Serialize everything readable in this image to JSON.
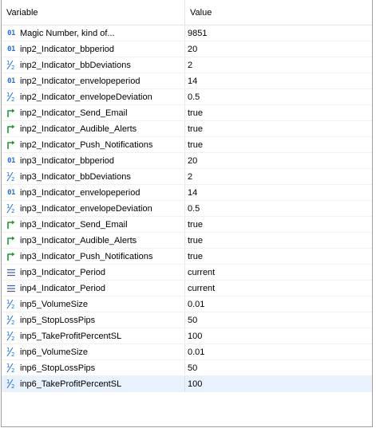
{
  "header": {
    "variable": "Variable",
    "value": "Value"
  },
  "icon_colors": {
    "int": "#2a6fc9",
    "double": "#2a6fc9",
    "bool": "#1f9a2e",
    "enum": "#3c5aa8"
  },
  "rows": [
    {
      "icon": "int-icon",
      "name": "Magic Number, kind of...",
      "value": "9851"
    },
    {
      "icon": "int-icon",
      "name": "inp2_Indicator_bbperiod",
      "value": "20"
    },
    {
      "icon": "double-icon",
      "name": "inp2_Indicator_bbDeviations",
      "value": "2"
    },
    {
      "icon": "int-icon",
      "name": "inp2_Indicator_envelopeperiod",
      "value": "14"
    },
    {
      "icon": "double-icon",
      "name": "inp2_Indicator_envelopeDeviation",
      "value": "0.5"
    },
    {
      "icon": "bool-icon",
      "name": "inp2_Indicator_Send_Email",
      "value": "true"
    },
    {
      "icon": "bool-icon",
      "name": "inp2_Indicator_Audible_Alerts",
      "value": "true"
    },
    {
      "icon": "bool-icon",
      "name": "inp2_Indicator_Push_Notifications",
      "value": "true"
    },
    {
      "icon": "int-icon",
      "name": "inp3_Indicator_bbperiod",
      "value": "20"
    },
    {
      "icon": "double-icon",
      "name": "inp3_Indicator_bbDeviations",
      "value": "2"
    },
    {
      "icon": "int-icon",
      "name": "inp3_Indicator_envelopeperiod",
      "value": "14"
    },
    {
      "icon": "double-icon",
      "name": "inp3_Indicator_envelopeDeviation",
      "value": "0.5"
    },
    {
      "icon": "bool-icon",
      "name": "inp3_Indicator_Send_Email",
      "value": "true"
    },
    {
      "icon": "bool-icon",
      "name": "inp3_Indicator_Audible_Alerts",
      "value": "true"
    },
    {
      "icon": "bool-icon",
      "name": "inp3_Indicator_Push_Notifications",
      "value": "true"
    },
    {
      "icon": "enum-icon",
      "name": "inp3_Indicator_Period",
      "value": "current"
    },
    {
      "icon": "enum-icon",
      "name": "inp4_Indicator_Period",
      "value": "current"
    },
    {
      "icon": "double-icon",
      "name": "inp5_VolumeSize",
      "value": "0.01"
    },
    {
      "icon": "double-icon",
      "name": "inp5_StopLossPips",
      "value": "50"
    },
    {
      "icon": "double-icon",
      "name": "inp5_TakeProfitPercentSL",
      "value": "100"
    },
    {
      "icon": "double-icon",
      "name": "inp6_VolumeSize",
      "value": "0.01"
    },
    {
      "icon": "double-icon",
      "name": "inp6_StopLossPips",
      "value": "50"
    },
    {
      "icon": "double-icon",
      "name": "inp6_TakeProfitPercentSL",
      "value": "100",
      "selected": true
    }
  ]
}
